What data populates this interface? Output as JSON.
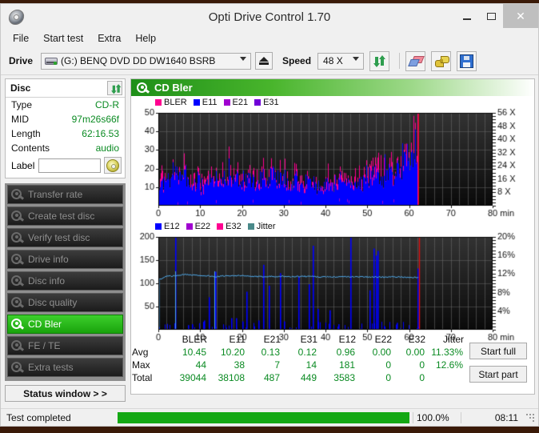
{
  "window": {
    "title": "Opti Drive Control 1.70",
    "app_icon": "disc-icon",
    "minimize": "–",
    "maximize": "□",
    "close": "✕"
  },
  "menu": {
    "items": [
      "File",
      "Start test",
      "Extra",
      "Help"
    ]
  },
  "toolbar": {
    "drive_label": "Drive",
    "drive_value": "(G:)   BENQ DVD DD DW1640 BSRB",
    "eject_title": "Eject",
    "speed_label": "Speed",
    "speed_value": "48 X",
    "icons": [
      "refresh-icon",
      "eraser-icon",
      "plug-icon",
      "save-icon"
    ]
  },
  "disc_panel": {
    "title": "Disc",
    "refresh_icon": "refresh-icon",
    "rows": [
      {
        "key": "Type",
        "value": "CD-R"
      },
      {
        "key": "MID",
        "value": "97m26s66f"
      },
      {
        "key": "Length",
        "value": "62:16.53"
      },
      {
        "key": "Contents",
        "value": "audio"
      }
    ],
    "label_key": "Label",
    "label_value": "",
    "label_placeholder": "",
    "label_button_icon": "cd-icon"
  },
  "sidebar": {
    "items": [
      {
        "label": "Transfer rate",
        "active": false
      },
      {
        "label": "Create test disc",
        "active": false
      },
      {
        "label": "Verify test disc",
        "active": false
      },
      {
        "label": "Drive info",
        "active": false
      },
      {
        "label": "Disc info",
        "active": false
      },
      {
        "label": "Disc quality",
        "active": false
      },
      {
        "label": "CD Bler",
        "active": true
      },
      {
        "label": "FE / TE",
        "active": false
      },
      {
        "label": "Extra tests",
        "active": false
      }
    ],
    "status_window_button": "Status window > >"
  },
  "main": {
    "header_title": "CD Bler",
    "header_icon": "disc-test-icon",
    "start_full_button": "Start full",
    "start_part_button": "Start part"
  },
  "statusbar": {
    "text": "Test completed",
    "progress_percent": "100.0%",
    "progress_value": 100,
    "elapsed": "08:11"
  },
  "colors": {
    "bler": "#ff0090",
    "e11": "#0000ff",
    "e21": "#a000d0",
    "e31": "#7000d8",
    "e12": "#0000ff",
    "e22": "#a000d0",
    "e32": "#ff0090",
    "jitter": "#4fa8e8",
    "accent_green": "#19a30c",
    "value_green": "#0a8a22",
    "marker_red": "#e01010"
  },
  "chart_data": [
    {
      "type": "area",
      "id": "cd-bler-chart",
      "title": "CD Bler",
      "xlabel": "min",
      "ylabel": "",
      "xlim": [
        0,
        80
      ],
      "ylim": [
        0,
        50
      ],
      "xticks": [
        0,
        10,
        20,
        30,
        40,
        50,
        60,
        70,
        80
      ],
      "xtick_labels": [
        "0",
        "10",
        "20",
        "30",
        "40",
        "50",
        "60",
        "70",
        "80 min"
      ],
      "yticks": [
        10,
        20,
        30,
        40,
        50
      ],
      "y2label": "X",
      "y2lim": [
        0,
        56
      ],
      "y2ticks": [
        8,
        16,
        24,
        32,
        40,
        48,
        56
      ],
      "y2tick_labels": [
        "8 X",
        "16 X",
        "24 X",
        "32 X",
        "40 X",
        "48 X",
        "56 X"
      ],
      "grid": true,
      "legend": [
        {
          "name": "BLER",
          "color": "#ff0090"
        },
        {
          "name": "E11",
          "color": "#0000ff"
        },
        {
          "name": "E21",
          "color": "#a000d0"
        },
        {
          "name": "E31",
          "color": "#7000d8"
        }
      ],
      "legend_position": "top-left",
      "data_end_x": 62.3,
      "series": [
        {
          "name": "BLER",
          "color": "#ff0090",
          "x": [
            0,
            1,
            2,
            3,
            4,
            5,
            6,
            7,
            8,
            9,
            10,
            11,
            12,
            13,
            14,
            15,
            16,
            17,
            18,
            19,
            20,
            21,
            22,
            23,
            24,
            25,
            26,
            27,
            28,
            29,
            30,
            31,
            32,
            33,
            34,
            35,
            36,
            37,
            38,
            39,
            40,
            41,
            42,
            43,
            44,
            45,
            46,
            47,
            48,
            49,
            50,
            51,
            52,
            53,
            54,
            55,
            56,
            57,
            58,
            59,
            60,
            61,
            62,
            62.3
          ],
          "values": [
            23,
            21,
            19,
            25,
            28,
            20,
            30,
            22,
            21,
            19,
            17,
            16,
            18,
            20,
            17,
            21,
            26,
            28,
            24,
            20,
            19,
            21,
            23,
            20,
            18,
            28,
            21,
            24,
            25,
            22,
            26,
            21,
            19,
            22,
            20,
            18,
            19,
            20,
            17,
            16,
            18,
            20,
            17,
            19,
            21,
            18,
            17,
            20,
            19,
            21,
            23,
            26,
            34,
            24,
            26,
            28,
            27,
            30,
            32,
            36,
            38,
            41,
            49,
            50
          ]
        },
        {
          "name": "E11",
          "color": "#0000ff",
          "x": [
            0,
            1,
            2,
            3,
            4,
            5,
            6,
            7,
            8,
            9,
            10,
            11,
            12,
            13,
            14,
            15,
            16,
            17,
            18,
            19,
            20,
            21,
            22,
            23,
            24,
            25,
            26,
            27,
            28,
            29,
            30,
            31,
            32,
            33,
            34,
            35,
            36,
            37,
            38,
            39,
            40,
            41,
            42,
            43,
            44,
            45,
            46,
            47,
            48,
            49,
            50,
            51,
            52,
            53,
            54,
            55,
            56,
            57,
            58,
            59,
            60,
            61,
            62,
            62.3
          ],
          "values": [
            22,
            20,
            18,
            24,
            26,
            18,
            30,
            21,
            20,
            17,
            15,
            14,
            16,
            19,
            16,
            20,
            24,
            26,
            22,
            18,
            17,
            20,
            21,
            18,
            16,
            27,
            19,
            22,
            24,
            20,
            24,
            19,
            17,
            20,
            18,
            16,
            17,
            18,
            15,
            14,
            16,
            18,
            15,
            17,
            19,
            16,
            15,
            18,
            17,
            19,
            21,
            24,
            21,
            22,
            24,
            26,
            25,
            28,
            30,
            34,
            36,
            39,
            40,
            40
          ]
        }
      ],
      "notes": "Dense per-sample BLER/E11 error bars 0-62.3 min; blue E11 fill dominant with magenta BLER peaks; rising trend after 55 min; tall red/magenta spike at end of data (~62.3 min); area beyond 62.3 min is empty black."
    },
    {
      "type": "line",
      "id": "e12-jitter-chart",
      "title": "",
      "xlabel": "min",
      "ylabel": "",
      "xlim": [
        0,
        80
      ],
      "ylim": [
        0,
        200
      ],
      "xticks": [
        0,
        10,
        20,
        30,
        40,
        50,
        60,
        70,
        80
      ],
      "xtick_labels": [
        "0",
        "10",
        "20",
        "30",
        "40",
        "50",
        "60",
        "70",
        "80 min"
      ],
      "yticks": [
        50,
        100,
        150,
        200
      ],
      "y2lim": [
        0,
        20
      ],
      "y2ticks": [
        4,
        8,
        12,
        16,
        20
      ],
      "y2tick_labels": [
        "4%",
        "8%",
        "12%",
        "16%",
        "20%"
      ],
      "grid": true,
      "legend": [
        {
          "name": "E12",
          "color": "#0000ff"
        },
        {
          "name": "E22",
          "color": "#a000d0"
        },
        {
          "name": "E32",
          "color": "#ff0090"
        },
        {
          "name": "Jitter",
          "color": "#4a8a8a"
        }
      ],
      "legend_position": "top-left",
      "data_end_x": 62.3,
      "series": [
        {
          "name": "Jitter",
          "color": "#4fa8e8",
          "unit": "%",
          "x": [
            0,
            2,
            4,
            6,
            8,
            10,
            12,
            14,
            16,
            18,
            20,
            22,
            24,
            26,
            28,
            30,
            32,
            34,
            36,
            38,
            40,
            42,
            44,
            46,
            48,
            50,
            52,
            54,
            56,
            58,
            60,
            62,
            62.3
          ],
          "values": [
            10.8,
            11.5,
            11.6,
            11.9,
            11.8,
            11.7,
            11.6,
            11.4,
            11.6,
            11.7,
            11.6,
            11.5,
            11.4,
            11.5,
            11.5,
            11.5,
            11.4,
            11.5,
            11.5,
            11.4,
            11.4,
            11.4,
            11.4,
            11.4,
            11.4,
            11.4,
            11.4,
            11.3,
            11.4,
            11.3,
            11.3,
            11.3,
            11.3
          ],
          "note": "Flat jitter trace around 11.3-11.9 %, plotted on right axis"
        },
        {
          "name": "E12",
          "color": "#0000ff",
          "x": [
            4,
            7,
            8,
            11,
            12,
            13.5,
            17.5,
            18.5,
            20,
            21,
            24,
            25,
            26.5,
            29,
            30,
            33.5,
            36,
            37,
            38,
            41,
            43,
            46,
            50.5,
            51.5,
            52,
            52.5,
            57,
            62
          ],
          "values": [
            200,
            10,
            12,
            20,
            70,
            125,
            25,
            25,
            18,
            82,
            20,
            140,
            95,
            122,
            18,
            115,
            98,
            181,
            45,
            42,
            12,
            200,
            85,
            175,
            160,
            170,
            15,
            132
          ],
          "note": "Sparse tall blue E12 spikes; several reach full scale"
        }
      ],
      "markers": [
        {
          "x": 62.3,
          "color": "#e01010",
          "note": "end-of-data vertical red marker line"
        }
      ],
      "notes": "Jitter line ~11.3% steady across disc; isolated E12 error spikes; recording ends at 62.3 min."
    },
    {
      "type": "table",
      "id": "stats-table",
      "title": "",
      "columns": [
        "",
        "BLER",
        "E11",
        "E21",
        "E31",
        "E12",
        "E22",
        "E32",
        "Jitter"
      ],
      "rows": [
        [
          "Avg",
          "10.45",
          "10.20",
          "0.13",
          "0.12",
          "0.96",
          "0.00",
          "0.00",
          "11.33%"
        ],
        [
          "Max",
          "44",
          "38",
          "7",
          "14",
          "181",
          "0",
          "0",
          "12.6%"
        ],
        [
          "Total",
          "39044",
          "38108",
          "487",
          "449",
          "3583",
          "0",
          "0",
          ""
        ]
      ]
    }
  ]
}
